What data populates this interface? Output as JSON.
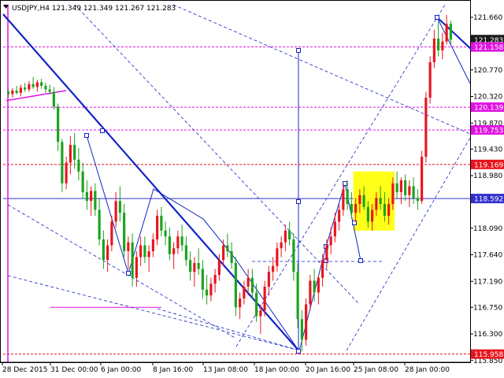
{
  "header": {
    "symbol_timeframe": "USDJPY,H4",
    "ohlc": "121.349 121.349 121.267 121.283"
  },
  "colors": {
    "bull": "#e8141e",
    "bear": "#19a31c",
    "trend_blue": "#1424c8",
    "level_red": "#e8141e",
    "level_magenta": "#e014e0",
    "level_blue": "#3030d0",
    "pattern_yellow": "#ffff00",
    "current_price_bg": "#1a1a1a"
  },
  "chart_data": {
    "type": "candlestick",
    "title": "USDJPY,H4",
    "y_axis_ticks": [
      "121.660",
      "120.770",
      "120.320",
      "119.870",
      "119.430",
      "118.980",
      "118.090",
      "117.640",
      "117.190",
      "116.750",
      "116.300",
      "115.850"
    ],
    "x_axis_ticks": [
      "28 Dec 2015",
      "31 Dec 00:00",
      "6 Jan 00:00",
      "8 Jan 16:00",
      "13 Jan 08:00",
      "18 Jan 00:00",
      "20 Jan 16:00",
      "25 Jan 08:00",
      "28 Jan 00:00"
    ],
    "ylim": [
      115.82,
      121.9
    ],
    "price_labels": [
      {
        "value": 121.283,
        "text": "121.283",
        "style": "current"
      },
      {
        "value": 121.158,
        "text": "121.158",
        "style": "magenta"
      },
      {
        "value": 120.139,
        "text": "120.139",
        "style": "magenta"
      },
      {
        "value": 119.753,
        "text": "119.753",
        "style": "magenta"
      },
      {
        "value": 119.169,
        "text": "119.169",
        "style": "red"
      },
      {
        "value": 118.592,
        "text": "118.592",
        "style": "blue"
      },
      {
        "value": 115.958,
        "text": "115.958",
        "style": "red"
      }
    ],
    "grid": false,
    "candles": [
      [
        120.4,
        120.45,
        120.3,
        120.36
      ],
      [
        120.36,
        120.46,
        120.3,
        120.42
      ],
      [
        120.42,
        120.5,
        120.35,
        120.38
      ],
      [
        120.38,
        120.52,
        120.32,
        120.47
      ],
      [
        120.47,
        120.55,
        120.4,
        120.44
      ],
      [
        120.44,
        120.58,
        120.4,
        120.53
      ],
      [
        120.53,
        120.65,
        120.45,
        120.48
      ],
      [
        120.48,
        120.6,
        120.4,
        120.56
      ],
      [
        120.56,
        120.62,
        120.45,
        120.5
      ],
      [
        120.5,
        120.55,
        120.38,
        120.44
      ],
      [
        120.44,
        120.52,
        120.35,
        120.4
      ],
      [
        120.4,
        120.48,
        120.1,
        120.15
      ],
      [
        120.15,
        120.2,
        119.4,
        119.55
      ],
      [
        119.55,
        119.6,
        118.7,
        118.85
      ],
      [
        118.85,
        119.3,
        118.75,
        119.2
      ],
      [
        119.2,
        119.65,
        119.0,
        119.5
      ],
      [
        119.5,
        119.7,
        119.1,
        119.25
      ],
      [
        119.25,
        119.45,
        118.9,
        119.05
      ],
      [
        119.05,
        119.2,
        118.6,
        118.7
      ],
      [
        118.7,
        118.9,
        118.4,
        118.55
      ],
      [
        118.55,
        118.8,
        118.3,
        118.72
      ],
      [
        118.72,
        118.85,
        118.3,
        118.4
      ],
      [
        118.4,
        118.6,
        117.8,
        117.9
      ],
      [
        117.9,
        118.05,
        117.4,
        117.55
      ],
      [
        117.55,
        117.9,
        117.35,
        117.8
      ],
      [
        117.8,
        118.3,
        117.7,
        118.2
      ],
      [
        118.2,
        118.7,
        118.1,
        118.55
      ],
      [
        118.55,
        118.8,
        118.2,
        118.35
      ],
      [
        118.35,
        118.5,
        117.6,
        117.7
      ],
      [
        117.7,
        117.95,
        117.4,
        117.85
      ],
      [
        117.85,
        118.0,
        117.1,
        117.25
      ],
      [
        117.25,
        117.7,
        117.1,
        117.6
      ],
      [
        117.6,
        117.95,
        117.45,
        117.8
      ],
      [
        117.8,
        117.95,
        117.5,
        117.6
      ],
      [
        117.6,
        117.8,
        117.35,
        117.7
      ],
      [
        117.7,
        118.0,
        117.6,
        117.9
      ],
      [
        117.9,
        118.4,
        117.8,
        118.3
      ],
      [
        118.3,
        118.45,
        117.95,
        118.05
      ],
      [
        118.05,
        118.2,
        117.8,
        117.95
      ],
      [
        117.95,
        118.1,
        117.55,
        117.65
      ],
      [
        117.65,
        117.85,
        117.4,
        117.75
      ],
      [
        117.75,
        118.05,
        117.65,
        117.95
      ],
      [
        117.95,
        118.15,
        117.7,
        117.8
      ],
      [
        117.8,
        117.95,
        117.45,
        117.55
      ],
      [
        117.55,
        117.7,
        117.2,
        117.35
      ],
      [
        117.35,
        117.6,
        117.1,
        117.5
      ],
      [
        117.5,
        117.75,
        117.3,
        117.4
      ],
      [
        117.4,
        117.55,
        116.9,
        117.05
      ],
      [
        117.05,
        117.3,
        116.8,
        116.95
      ],
      [
        116.95,
        117.25,
        116.85,
        117.15
      ],
      [
        117.15,
        117.4,
        117.0,
        117.3
      ],
      [
        117.3,
        117.65,
        117.2,
        117.55
      ],
      [
        117.55,
        117.9,
        117.45,
        117.8
      ],
      [
        117.8,
        118.0,
        117.6,
        117.7
      ],
      [
        117.7,
        117.85,
        117.4,
        117.5
      ],
      [
        117.5,
        117.6,
        116.6,
        116.75
      ],
      [
        116.75,
        117.0,
        116.55,
        116.9
      ],
      [
        116.9,
        117.2,
        116.8,
        117.1
      ],
      [
        117.1,
        117.4,
        116.95,
        117.25
      ],
      [
        117.25,
        117.4,
        116.9,
        117.0
      ],
      [
        117.0,
        117.15,
        116.5,
        116.6
      ],
      [
        116.6,
        116.8,
        116.3,
        116.7
      ],
      [
        116.7,
        117.2,
        116.6,
        117.1
      ],
      [
        117.1,
        117.45,
        116.95,
        117.35
      ],
      [
        117.35,
        117.6,
        117.2,
        117.45
      ],
      [
        117.45,
        117.85,
        117.35,
        117.75
      ],
      [
        117.75,
        117.95,
        117.6,
        117.85
      ],
      [
        117.85,
        118.15,
        117.7,
        118.05
      ],
      [
        118.05,
        118.2,
        117.8,
        117.9
      ],
      [
        117.9,
        118.0,
        117.2,
        117.35
      ],
      [
        117.35,
        117.5,
        116.4,
        116.55
      ],
      [
        116.55,
        116.7,
        116.0,
        116.2
      ],
      [
        116.2,
        116.9,
        116.1,
        116.8
      ],
      [
        116.8,
        117.3,
        116.7,
        117.2
      ],
      [
        117.2,
        117.4,
        116.85,
        117.0
      ],
      [
        117.0,
        117.3,
        116.8,
        117.25
      ],
      [
        117.25,
        117.65,
        117.1,
        117.55
      ],
      [
        117.55,
        117.9,
        117.4,
        117.8
      ],
      [
        117.8,
        118.1,
        117.65,
        117.95
      ],
      [
        117.95,
        118.35,
        117.85,
        118.2
      ],
      [
        118.2,
        118.5,
        118.05,
        118.4
      ],
      [
        118.4,
        118.85,
        118.3,
        118.75
      ],
      [
        118.75,
        118.9,
        118.4,
        118.5
      ],
      [
        118.5,
        118.7,
        118.25,
        118.35
      ],
      [
        118.35,
        118.6,
        118.2,
        118.5
      ],
      [
        118.5,
        118.75,
        118.35,
        118.65
      ],
      [
        118.65,
        118.8,
        118.4,
        118.45
      ],
      [
        118.45,
        118.55,
        118.1,
        118.2
      ],
      [
        118.2,
        118.5,
        118.05,
        118.4
      ],
      [
        118.4,
        118.7,
        118.3,
        118.6
      ],
      [
        118.6,
        118.8,
        118.4,
        118.5
      ],
      [
        118.5,
        118.7,
        118.2,
        118.3
      ],
      [
        118.3,
        118.6,
        118.15,
        118.5
      ],
      [
        118.5,
        118.95,
        118.4,
        118.85
      ],
      [
        118.85,
        119.05,
        118.6,
        118.7
      ],
      [
        118.7,
        118.95,
        118.5,
        118.9
      ],
      [
        118.9,
        119.0,
        118.55,
        118.65
      ],
      [
        118.65,
        118.9,
        118.45,
        118.8
      ],
      [
        118.8,
        118.95,
        118.5,
        118.6
      ],
      [
        118.6,
        118.75,
        118.4,
        118.55
      ],
      [
        118.55,
        119.4,
        118.5,
        119.3
      ],
      [
        119.3,
        120.4,
        119.2,
        120.3
      ],
      [
        120.3,
        121.0,
        120.2,
        120.9
      ],
      [
        120.9,
        121.45,
        120.8,
        121.3
      ],
      [
        121.3,
        121.6,
        121.0,
        121.1
      ],
      [
        121.1,
        121.4,
        120.95,
        121.25
      ],
      [
        121.25,
        121.7,
        121.2,
        121.55
      ],
      [
        121.55,
        121.6,
        121.2,
        121.28
      ]
    ]
  }
}
